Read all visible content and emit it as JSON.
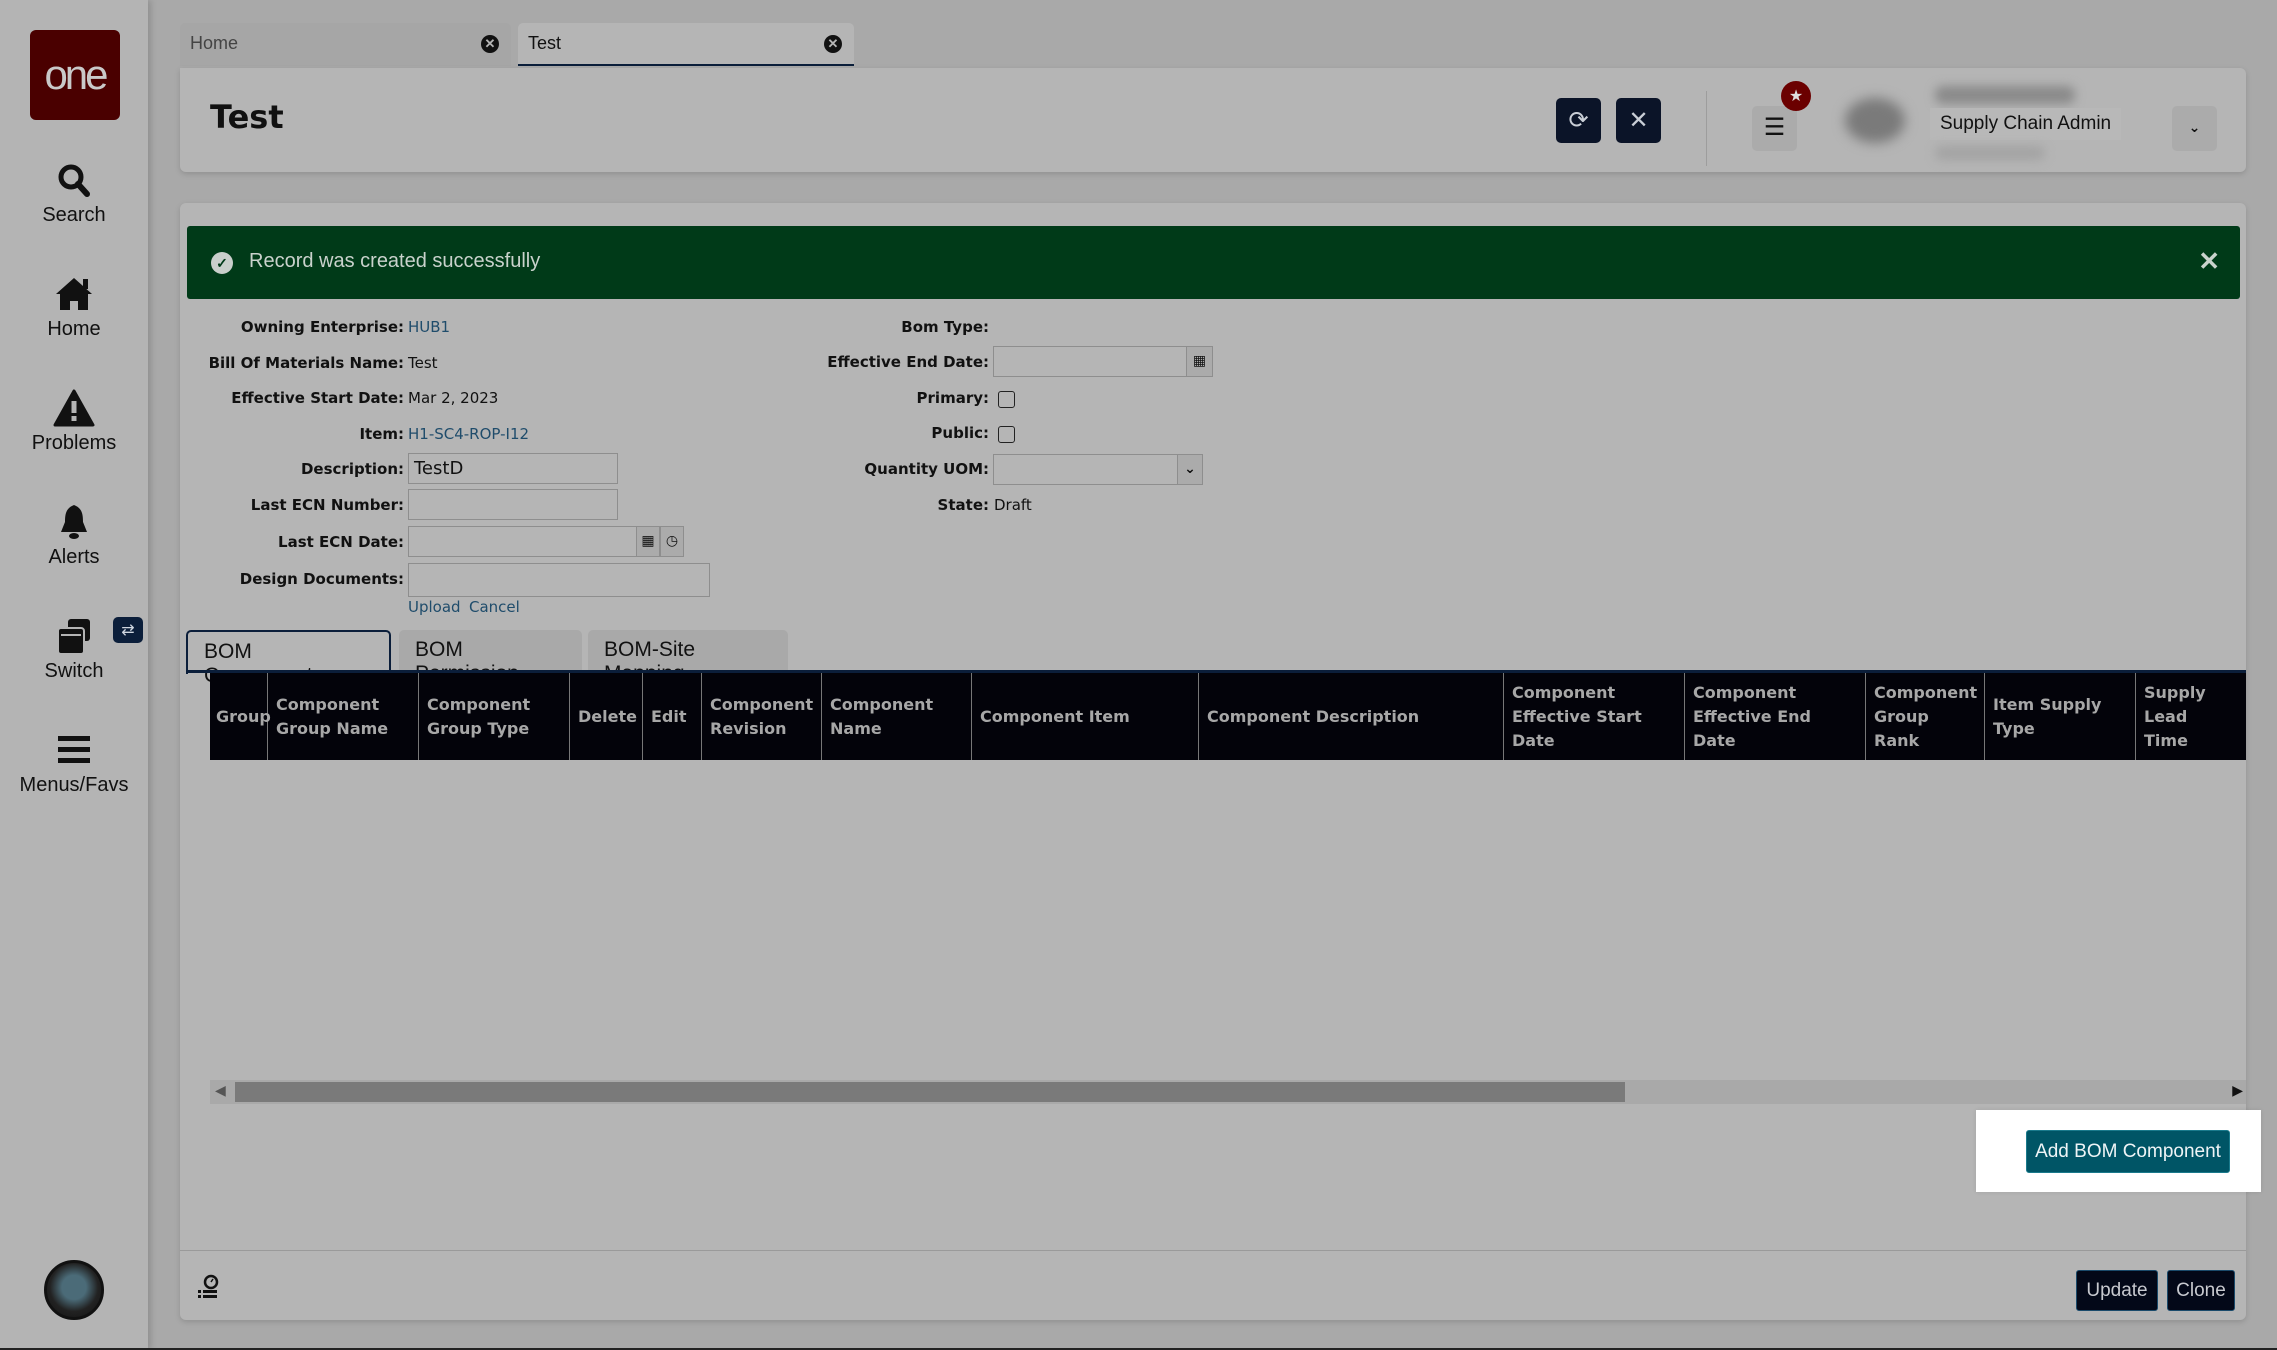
{
  "app": {
    "logo_text": "one"
  },
  "sidebar": {
    "items": [
      {
        "label": "Search",
        "icon": "search-icon"
      },
      {
        "label": "Home",
        "icon": "home-icon"
      },
      {
        "label": "Problems",
        "icon": "warning-icon"
      },
      {
        "label": "Alerts",
        "icon": "bell-icon"
      },
      {
        "label": "Switch",
        "icon": "switch-windows-icon",
        "badge_icon": "swap-arrows-icon"
      },
      {
        "label": "Menus/Favs",
        "icon": "hamburger-icon"
      }
    ]
  },
  "tabs": [
    {
      "label": "Home",
      "active": false
    },
    {
      "label": "Test",
      "active": true
    }
  ],
  "header": {
    "title": "Test",
    "refresh_icon": "refresh-icon",
    "close_icon": "close-icon",
    "menu_icon": "menu-icon",
    "favorite_badge_icon": "star-icon",
    "user_role": "Supply Chain Admin",
    "user_dropdown_icon": "chevron-down-icon"
  },
  "banner": {
    "message": "Record was created successfully",
    "color": "#003a18"
  },
  "form": {
    "left": {
      "owning_enterprise": {
        "label": "Owning Enterprise:",
        "value": "HUB1"
      },
      "bom_name": {
        "label": "Bill Of Materials Name:",
        "value": "Test"
      },
      "effective_start": {
        "label": "Effective Start Date:",
        "value": "Mar 2, 2023"
      },
      "item": {
        "label": "Item:",
        "value": "H1-SC4-ROP-I12"
      },
      "description": {
        "label": "Description:",
        "value": "TestD"
      },
      "last_ecn_number": {
        "label": "Last ECN Number:",
        "value": ""
      },
      "last_ecn_date": {
        "label": "Last ECN Date:",
        "value": ""
      },
      "design_documents": {
        "label": "Design Documents:",
        "value": "",
        "upload_label": "Upload",
        "cancel_label": "Cancel"
      }
    },
    "right": {
      "bom_type": {
        "label": "Bom Type:",
        "value": ""
      },
      "effective_end": {
        "label": "Effective End Date:",
        "value": ""
      },
      "primary": {
        "label": "Primary:",
        "checked": false
      },
      "public": {
        "label": "Public:",
        "checked": false
      },
      "quantity_uom": {
        "label": "Quantity UOM:",
        "value": ""
      },
      "state": {
        "label": "State:",
        "value": "Draft"
      }
    }
  },
  "bom_tabs": [
    {
      "label": "BOM Components",
      "active": true
    },
    {
      "label": "BOM Permission",
      "active": false
    },
    {
      "label": "BOM-Site Mapping",
      "active": false
    }
  ],
  "table": {
    "columns": [
      "Group",
      "Component\nGroup Name",
      "Component\nGroup Type",
      "Delete",
      "Edit",
      "Component\nRevision",
      "Component\nName",
      "Component Item",
      "Component Description",
      "Component\nEffective Start Date",
      "Component\nEffective End Date",
      "Component\nGroup Rank",
      "Item Supply\nType",
      "Supply Lead\nTime"
    ],
    "rows": []
  },
  "actions": {
    "add_bom_component": "Add BOM Component",
    "update": "Update",
    "clone": "Clone"
  }
}
